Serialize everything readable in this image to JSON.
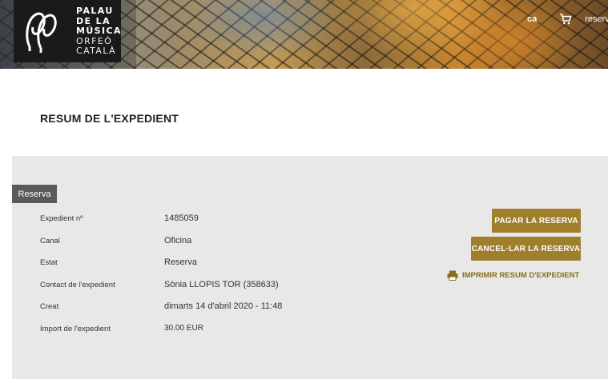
{
  "header": {
    "logo_lines": [
      "PALAU",
      "DE LA",
      "MÚSICA",
      "ORFEÓ",
      "CATALÀ"
    ],
    "language": "ca",
    "reserve_link": "reserve"
  },
  "page": {
    "title": "RESUM DE L'EXPEDIENT"
  },
  "panel": {
    "tab_label": "Reserva",
    "fields": [
      {
        "label": "Expedient nº",
        "value": "1485059"
      },
      {
        "label": "Canal",
        "value": "Oficina"
      },
      {
        "label": "Estat",
        "value": "Reserva"
      },
      {
        "label": "Contact de l'expedient",
        "value": "Sònia LLOPIS TOR (358633)"
      },
      {
        "label": "Creat",
        "value": "dimarts 14 d'abril 2020 - 11:48"
      },
      {
        "label": "Import de l'expedient",
        "value": "30.00 EUR"
      }
    ],
    "actions": {
      "pay": "PAGAR LA RESERVA",
      "cancel": "CANCEL·LAR LA RESERVA",
      "print": "IMPRIMIR RESUM D'EXPEDIENT"
    }
  },
  "colors": {
    "accent": "#a07f2c",
    "panel_bg": "#e8e8e8",
    "tab_bg": "#5a5a5a"
  }
}
